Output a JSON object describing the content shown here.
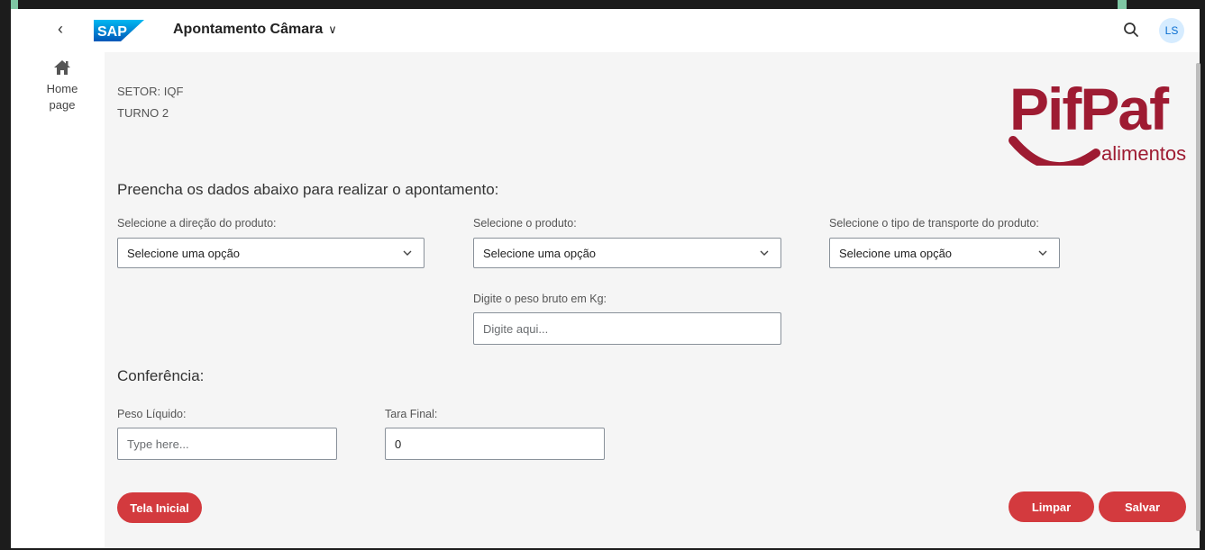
{
  "shell": {
    "back_icon": "chevron-left-icon",
    "logo_text": "SAP",
    "app_title": "Apontamento Câmara",
    "search_icon": "search-icon",
    "user_initials": "LS"
  },
  "sidenav": {
    "home_line1": "Home",
    "home_line2": "page",
    "home_icon": "home-icon"
  },
  "header": {
    "sector": "SETOR: IQF",
    "shift": "TURNO 2",
    "brand_logo_text": "PifPaf alimentos"
  },
  "form": {
    "instruction": "Preencha os dados abaixo para realizar o apontamento:",
    "direction_label": "Selecione a direção do produto:",
    "direction_value": "Selecione uma opção",
    "product_label": "Selecione o produto:",
    "product_value": "Selecione uma opção",
    "transport_label": "Selecione o tipo de transporte do produto:",
    "transport_value": "Selecione uma opção",
    "weight_label": "Digite o peso bruto em Kg:",
    "weight_placeholder": "Digite aqui..."
  },
  "conference": {
    "title": "Conferência:",
    "net_weight_label": "Peso Líquido:",
    "net_weight_placeholder": "Type here...",
    "tare_label": "Tara Final:",
    "tare_value": "0"
  },
  "actions": {
    "home_button": "Tela Inicial",
    "clear_button": "Limpar",
    "save_button": "Salvar"
  },
  "colors": {
    "accent_button": "#d33a3e",
    "brand": "#9e1b32",
    "avatar_bg": "#d6ecff",
    "sap_blue": "#0a6ed1"
  }
}
